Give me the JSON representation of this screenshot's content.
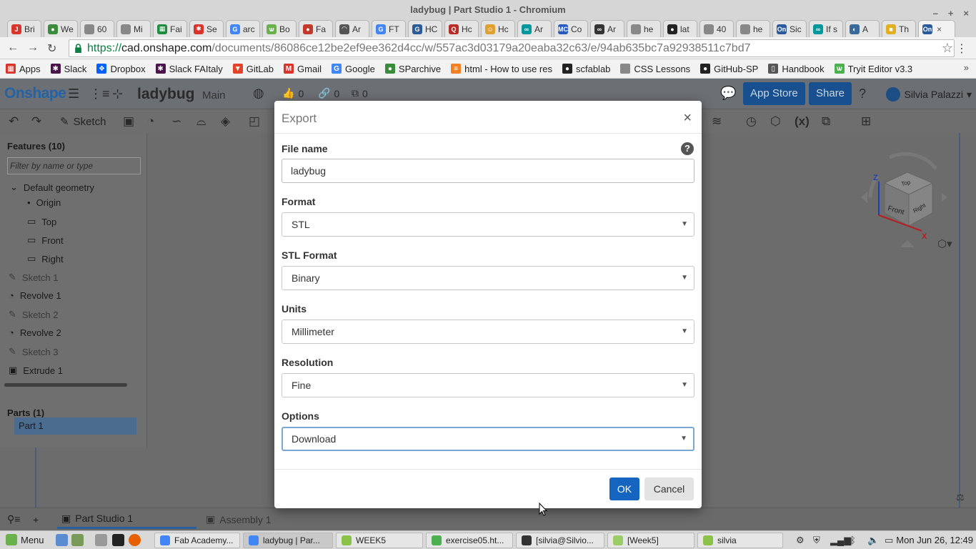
{
  "window": {
    "title": "ladybug | Part Studio 1 - Chromium",
    "controls": [
      "–",
      "+",
      "×"
    ]
  },
  "tabs": [
    {
      "label": "Bri",
      "color": "#d9342b",
      "glyph": "J"
    },
    {
      "label": "We",
      "color": "#3a8c3a",
      "glyph": "●"
    },
    {
      "label": "60",
      "color": "#888888",
      "glyph": ""
    },
    {
      "label": "Mi",
      "color": "#888888",
      "glyph": ""
    },
    {
      "label": "Fai",
      "color": "#1e8e3e",
      "glyph": "▦"
    },
    {
      "label": "Se",
      "color": "#d9342b",
      "glyph": "✱"
    },
    {
      "label": "arc",
      "color": "#4285f4",
      "glyph": "G"
    },
    {
      "label": "Bo",
      "color": "#6ab04c",
      "glyph": "ѡ"
    },
    {
      "label": "Fa",
      "color": "#c0392b",
      "glyph": "●"
    },
    {
      "label": "Ar",
      "color": "#555555",
      "glyph": "◠"
    },
    {
      "label": "FT",
      "color": "#4285f4",
      "glyph": "G"
    },
    {
      "label": "HC",
      "color": "#2a5a9a",
      "glyph": "G"
    },
    {
      "label": "Hc",
      "color": "#b92b27",
      "glyph": "Q"
    },
    {
      "label": "Hc",
      "color": "#e0a030",
      "glyph": "☺"
    },
    {
      "label": "Ar",
      "color": "#00979d",
      "glyph": "∞"
    },
    {
      "label": "Co",
      "color": "#2a5ac0",
      "glyph": "MC"
    },
    {
      "label": "Ar",
      "color": "#333333",
      "glyph": "∞"
    },
    {
      "label": "he",
      "color": "#888888",
      "glyph": ""
    },
    {
      "label": "lat",
      "color": "#222222",
      "glyph": "●"
    },
    {
      "label": "40",
      "color": "#888888",
      "glyph": ""
    },
    {
      "label": "he",
      "color": "#888888",
      "glyph": ""
    },
    {
      "label": "Sic",
      "color": "#2a5a9a",
      "glyph": "On"
    },
    {
      "label": "If s",
      "color": "#00979d",
      "glyph": "∞"
    },
    {
      "label": "A",
      "color": "#3a6a9a",
      "glyph": "◐"
    },
    {
      "label": "Th",
      "color": "#e0b020",
      "glyph": "■"
    }
  ],
  "active_tab": {
    "glyph": "On",
    "color": "#2a5a9a",
    "close": "×"
  },
  "address": {
    "protocol": "https://",
    "host": "cad.onshape.com",
    "path": "/documents/86086ce12be2ef9ee362d4cc/w/557ac3d03179a20eaba32c63/e/94ab635bc7a92938511c7bd7",
    "star": "☆",
    "menu": "⋮"
  },
  "nav": {
    "back": "←",
    "forward": "→",
    "reload": "↻"
  },
  "bookmarks": [
    {
      "label": "Apps",
      "color": "#d9342b",
      "glyph": "▦"
    },
    {
      "label": "Slack",
      "color": "#4a154b",
      "glyph": "✱"
    },
    {
      "label": "Dropbox",
      "color": "#0061fe",
      "glyph": "❖"
    },
    {
      "label": "Slack FAItaly",
      "color": "#4a154b",
      "glyph": "✱"
    },
    {
      "label": "GitLab",
      "color": "#e24329",
      "glyph": "▼"
    },
    {
      "label": "Gmail",
      "color": "#d9342b",
      "glyph": "M"
    },
    {
      "label": "Google",
      "color": "#4285f4",
      "glyph": "G"
    },
    {
      "label": "SParchive",
      "color": "#3a8c3a",
      "glyph": "●"
    },
    {
      "label": "html - How to use res",
      "color": "#f48024",
      "glyph": "≡"
    },
    {
      "label": "scfablab",
      "color": "#222222",
      "glyph": "●"
    },
    {
      "label": "CSS Lessons",
      "color": "#888888",
      "glyph": ""
    },
    {
      "label": "GitHub-SP",
      "color": "#222222",
      "glyph": "●"
    },
    {
      "label": "Handbook",
      "color": "#555555",
      "glyph": "▯"
    },
    {
      "label": "Tryit Editor v3.3",
      "color": "#4caf50",
      "glyph": "ѡ"
    }
  ],
  "bookmarks_more": "»",
  "app": {
    "brand": "Onshape",
    "doc_name": "ladybug",
    "branch": "Main",
    "likes": "0",
    "links": "0",
    "copies": "0",
    "app_store": "App Store",
    "share": "Share",
    "help": "?",
    "user": "Silvia Palazzi",
    "sketch_tool": "Sketch"
  },
  "features": {
    "header": "Features (10)",
    "filter_placeholder": "Filter by name or type",
    "items": [
      {
        "label": "Default geometry",
        "dim": false
      },
      {
        "label": "Origin",
        "dim": false
      },
      {
        "label": "Top",
        "dim": false
      },
      {
        "label": "Front",
        "dim": false
      },
      {
        "label": "Right",
        "dim": false
      },
      {
        "label": "Sketch 1",
        "dim": true
      },
      {
        "label": "Revolve 1",
        "dim": false
      },
      {
        "label": "Sketch 2",
        "dim": true
      },
      {
        "label": "Revolve 2",
        "dim": false
      },
      {
        "label": "Sketch 3",
        "dim": true
      },
      {
        "label": "Extrude 1",
        "dim": false
      }
    ],
    "parts_header": "Parts (1)",
    "parts": [
      "Part 1"
    ]
  },
  "viewcube": {
    "top": "Top",
    "front": "Front",
    "right": "Right",
    "z": "Z",
    "x": "X"
  },
  "bottom_tabs": [
    {
      "label": "Part Studio 1"
    },
    {
      "label": "Assembly 1"
    }
  ],
  "dialog": {
    "title": "Export",
    "close": "×",
    "help": "?",
    "file_name_label": "File name",
    "file_name_value": "ladybug",
    "format_label": "Format",
    "format_value": "STL",
    "stl_format_label": "STL Format",
    "stl_format_value": "Binary",
    "units_label": "Units",
    "units_value": "Millimeter",
    "resolution_label": "Resolution",
    "resolution_value": "Fine",
    "options_label": "Options",
    "options_value": "Download",
    "ok": "OK",
    "cancel": "Cancel"
  },
  "taskbar": {
    "menu": "Menu",
    "tasks": [
      {
        "label": "Fab Academy...",
        "color": "#4285f4",
        "active": false
      },
      {
        "label": "ladybug | Par...",
        "color": "#4285f4",
        "active": true
      },
      {
        "label": "WEEK5",
        "color": "#8bc34a",
        "active": false
      },
      {
        "label": "exercise05.ht...",
        "color": "#4caf50",
        "active": false
      },
      {
        "label": "[silvia@Silvio...",
        "color": "#333333",
        "active": false
      },
      {
        "label": "[Week5]",
        "color": "#9ccc65",
        "active": false
      },
      {
        "label": "silvia",
        "color": "#8bc34a",
        "active": false
      }
    ],
    "clock": "Mon Jun 26, 12:49"
  }
}
